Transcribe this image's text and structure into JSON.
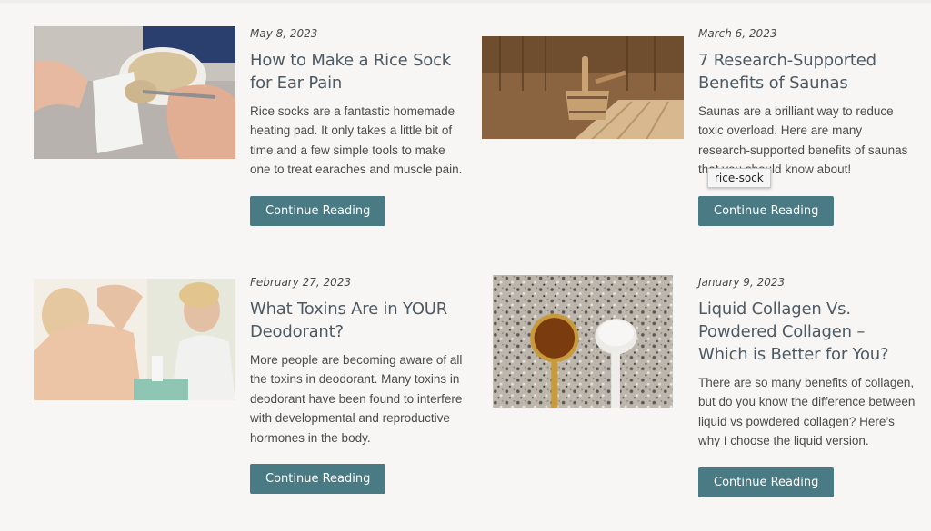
{
  "tooltip": "rice-sock",
  "posts": [
    {
      "date": "May 8, 2023",
      "title": "How to Make a Rice Sock for Ear Pain",
      "excerpt": "Rice socks are a fantastic homemade heating pad. It only takes a little bit of time and a few simple tools to make one to treat earaches and muscle pain.",
      "button": "Continue Reading"
    },
    {
      "date": "March 6, 2023",
      "title": "7 Research-Supported Benefits of Saunas",
      "excerpt": "Saunas are a brilliant way to reduce toxic overload. Here are many research-supported benefits of saunas that you should know about!",
      "button": "Continue Reading"
    },
    {
      "date": "February 27, 2023",
      "title": "What Toxins Are in YOUR Deodorant?",
      "excerpt": "More people are becoming aware of all the toxins in deodorant. Many toxins in deodorant have been found to interfere with developmental and reproductive hormones in the body.",
      "button": "Continue Reading"
    },
    {
      "date": "January 9, 2023",
      "title": "Liquid Collagen Vs. Powdered Collagen – Which is Better for You?",
      "excerpt": "There are so many benefits of collagen, but do you know the difference between liquid vs powdered collagen? Here’s why I choose the liquid version.",
      "button": "Continue Reading"
    }
  ],
  "colors": {
    "background": "#f8f6f5",
    "button": "#4a7b84",
    "title": "#4e5a63"
  }
}
